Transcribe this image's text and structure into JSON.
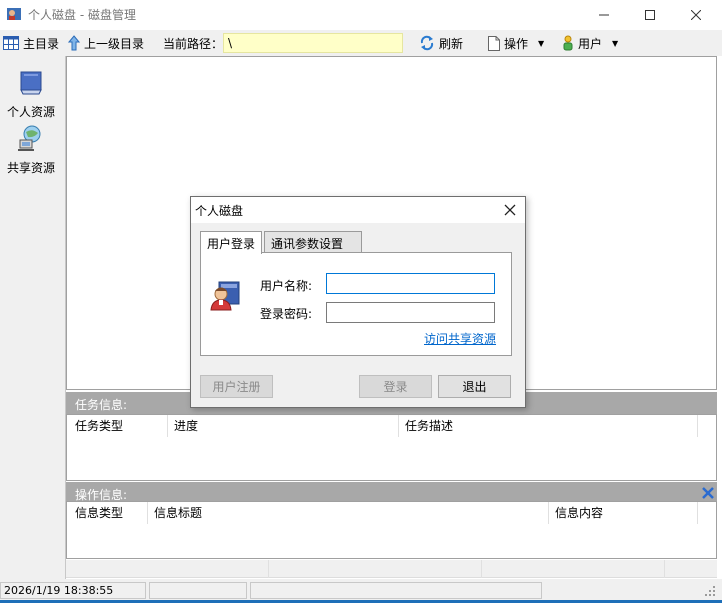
{
  "window": {
    "title": "个人磁盘  - 磁盘管理",
    "minimize_glyph": "—",
    "maximize_glyph": "☐",
    "close_glyph": "✕"
  },
  "toolbar": {
    "home_label": "主目录",
    "up_label": "上一级目录",
    "path_label": "当前路径：",
    "path_value": "\\",
    "refresh_label": "刷新",
    "operation_label": "操作",
    "user_label": "用户"
  },
  "sidebar": {
    "items": [
      {
        "label": "个人资源",
        "icon": "disk-icon"
      },
      {
        "label": "共享资源",
        "icon": "shared-network-icon"
      }
    ]
  },
  "tasks": {
    "header": "任务信息:",
    "columns": [
      "任务类型",
      "进度",
      "任务描述"
    ]
  },
  "operations": {
    "header": "操作信息:",
    "columns": [
      "信息类型",
      "信息标题",
      "信息内容"
    ]
  },
  "status": {
    "datetime": "2026/1/19 18:38:55"
  },
  "dialog": {
    "title": "个人磁盘",
    "tabs": [
      "用户登录",
      "通讯参数设置"
    ],
    "username_label": "用户名称:",
    "username_value": "",
    "password_label": "登录密码:",
    "password_value": "",
    "shared_link": "访问共享资源",
    "register_button": "用户注册",
    "login_button": "登录",
    "exit_button": "退出"
  },
  "colors": {
    "path_bg": "#ffffc8",
    "section_header_bg": "#a8a8a8",
    "link": "#0066cc",
    "accent": "#0078d7"
  }
}
